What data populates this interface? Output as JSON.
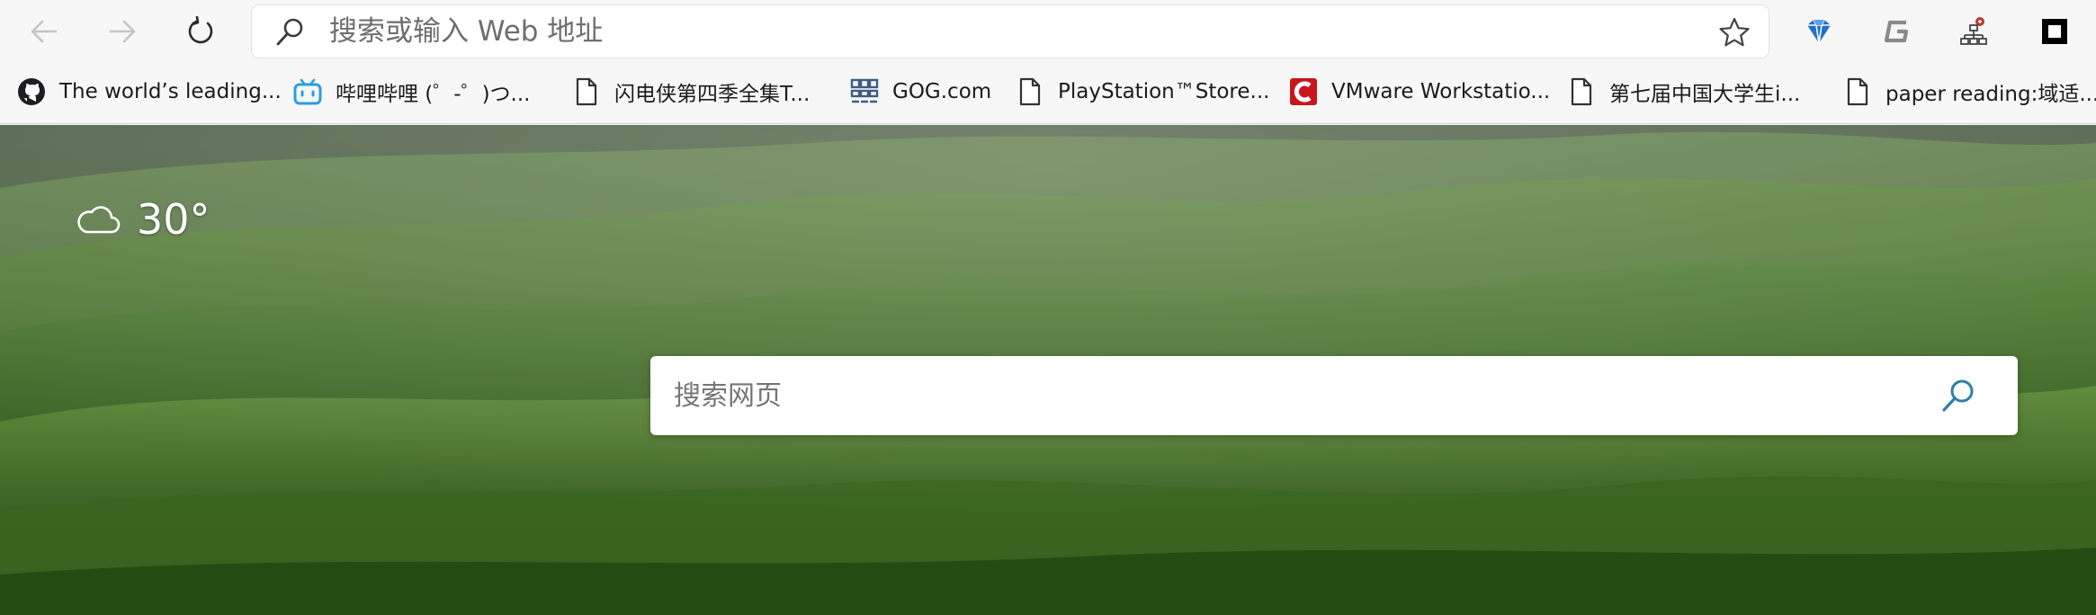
{
  "toolbar": {
    "back_icon": "arrow-left-icon",
    "forward_icon": "arrow-right-icon",
    "reload_icon": "refresh-icon",
    "favorite_icon": "star-icon"
  },
  "address_bar": {
    "placeholder": "搜索或输入 Web 地址",
    "value": ""
  },
  "extensions": [
    {
      "name": "diamond-extension-icon",
      "color": "#1e6fd0"
    },
    {
      "name": "g-extension-icon",
      "color": "#8a8a8a"
    },
    {
      "name": "sitemap-extension-icon",
      "color": "#c0392b"
    },
    {
      "name": "square-extension-icon",
      "color": "#000000"
    }
  ],
  "bookmarks": [
    {
      "label": "The world’s leading...",
      "icon": "github-icon"
    },
    {
      "label": "哔哩哔哩 (゜-゜)つ...",
      "icon": "bilibili-icon"
    },
    {
      "label": "闪电侠第四季全集T...",
      "icon": "page-icon"
    },
    {
      "label": "GOG.com",
      "icon": "gog-icon"
    },
    {
      "label": "PlayStation™Store...",
      "icon": "page-icon"
    },
    {
      "label": "VMware Workstatio...",
      "icon": "vmware-icon"
    },
    {
      "label": "第七届中国大学生i...",
      "icon": "page-icon"
    },
    {
      "label": "paper reading:域适...",
      "icon": "page-icon"
    }
  ],
  "weather": {
    "icon": "cloud-icon",
    "temperature": "30°"
  },
  "web_search": {
    "placeholder": "搜索网页",
    "icon": "search-icon",
    "accent": "#2f7fa8"
  }
}
